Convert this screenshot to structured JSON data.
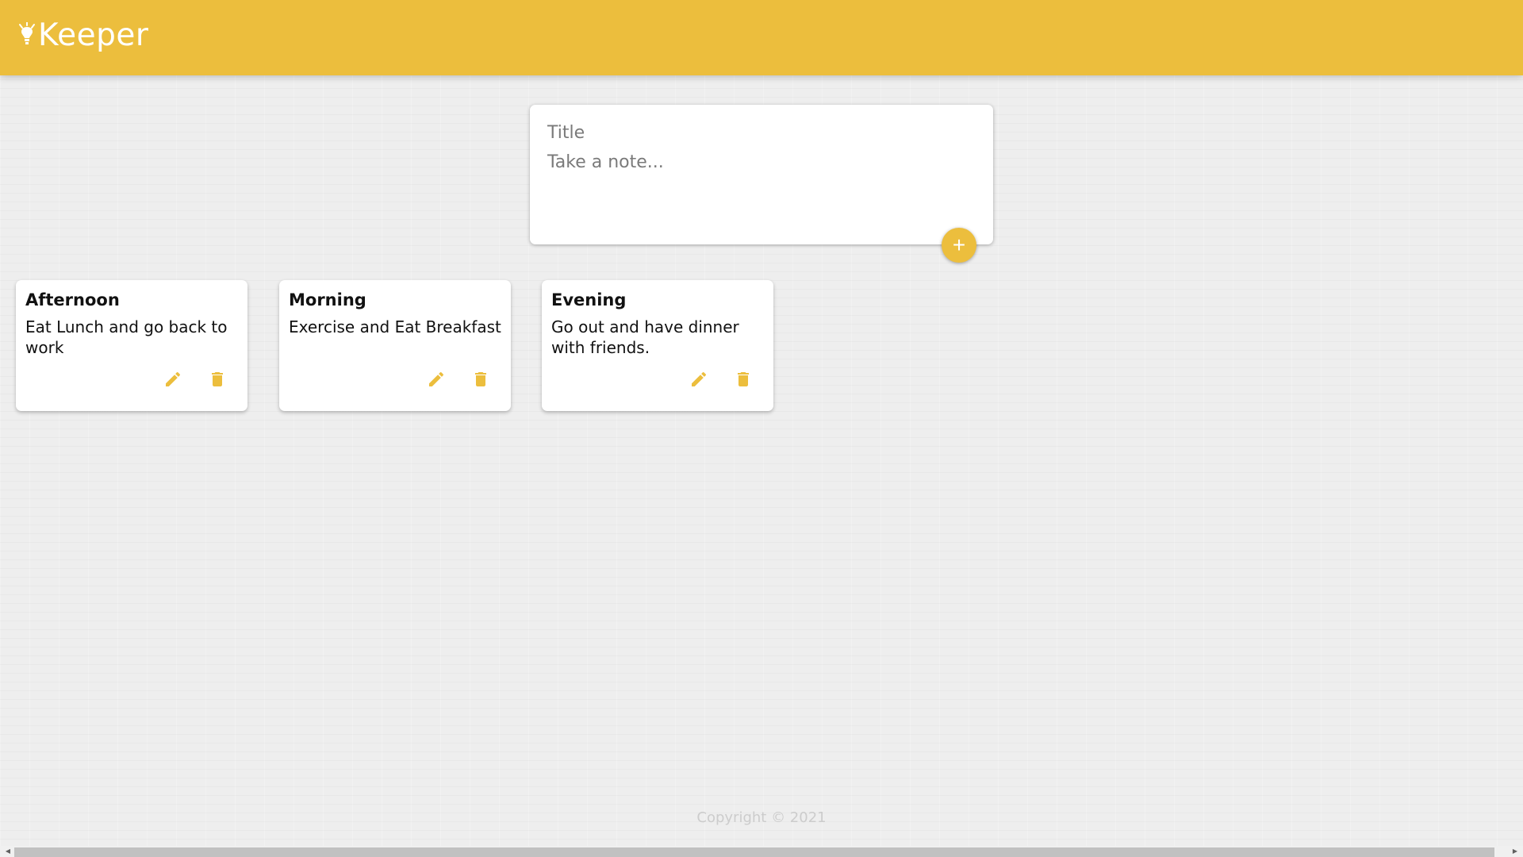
{
  "app": {
    "name": "Keeper",
    "accent_color": "#ecbe3d",
    "logo_icon": "lightbulb-icon"
  },
  "composer": {
    "title_placeholder": "Title",
    "content_placeholder": "Take a note...",
    "add_icon": "plus-icon",
    "add_label": "+"
  },
  "notes": [
    {
      "title": "Afternoon",
      "content": "Eat Lunch and go back to work",
      "edit_icon": "pencil-icon",
      "delete_icon": "trash-icon"
    },
    {
      "title": "Morning",
      "content": "Exercise and Eat Breakfast",
      "edit_icon": "pencil-icon",
      "delete_icon": "trash-icon"
    },
    {
      "title": "Evening",
      "content": "Go out and have dinner with friends.",
      "edit_icon": "pencil-icon",
      "delete_icon": "trash-icon"
    }
  ],
  "footer": {
    "copyright": "Copyright © 2021"
  },
  "scrollbar": {
    "left_arrow": "◀",
    "right_arrow": "▶"
  }
}
